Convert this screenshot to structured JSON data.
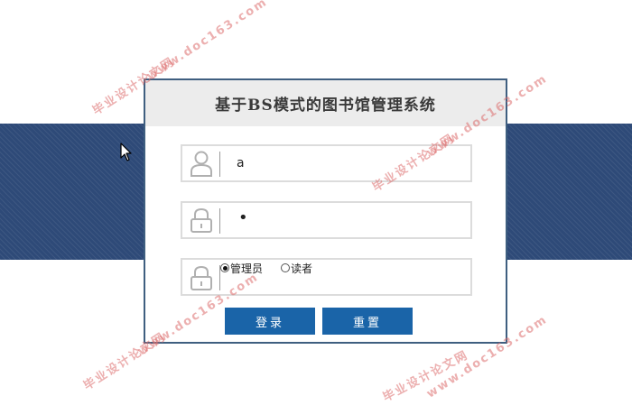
{
  "login": {
    "title": "基于BS模式的图书馆管理系统",
    "username_value": "a",
    "password_masked": "•",
    "roles": [
      {
        "label": "管理员",
        "checked": true
      },
      {
        "label": "读者",
        "checked": false
      }
    ],
    "login_label": "登录",
    "reset_label": "重置"
  },
  "watermarks": {
    "site": "毕业设计论文网",
    "url": "www.doc163.com"
  },
  "colors": {
    "band": "#2e4a78",
    "button": "#1a64a8",
    "header": "#ececec"
  },
  "icons": {
    "username": "user-icon",
    "password": "lock-icon",
    "role": "lock-icon"
  }
}
